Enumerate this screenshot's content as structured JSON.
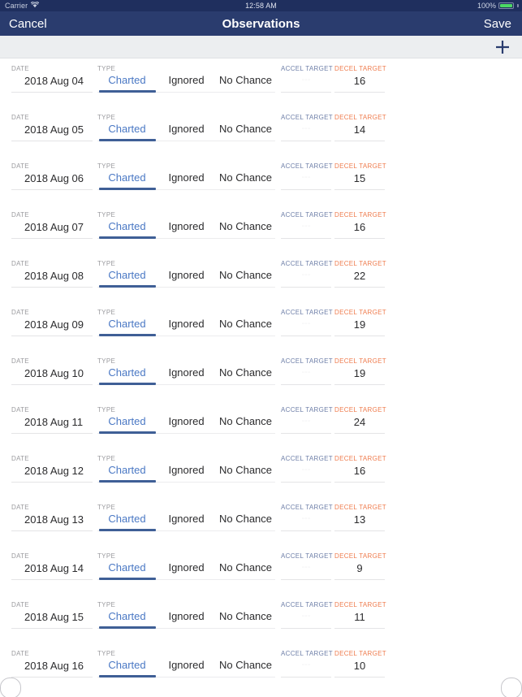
{
  "status_bar": {
    "carrier": "Carrier",
    "wifi_icon": "wifi-icon",
    "time": "12:58 AM",
    "battery_percent": "100%",
    "battery_icon": "battery-full-icon"
  },
  "nav_bar": {
    "cancel_label": "Cancel",
    "title": "Observations",
    "save_label": "Save"
  },
  "toolbar": {
    "add_icon": "plus-icon"
  },
  "columns": {
    "date_label": "DATE",
    "type_label": "TYPE",
    "accel_label": "ACCEL TARGET",
    "decel_label": "DECEL TARGET"
  },
  "type_options": [
    "Charted",
    "Ignored",
    "No Chance"
  ],
  "colors": {
    "status_bar_bg": "#1f2f5e",
    "nav_bar_bg": "#2a3c6e",
    "toolbar_bg": "#eceef0",
    "selected_segment": "#4a78c4",
    "segment_underline": "#3f5f96",
    "accel_label": "#6e7fa8",
    "decel_label": "#ef7c4e",
    "battery_green": "#4cd964"
  },
  "rows": [
    {
      "date": "2018 Aug 04",
      "type": "Charted",
      "accel": "",
      "decel": "16"
    },
    {
      "date": "2018 Aug 05",
      "type": "Charted",
      "accel": "",
      "decel": "14"
    },
    {
      "date": "2018 Aug 06",
      "type": "Charted",
      "accel": "",
      "decel": "15"
    },
    {
      "date": "2018 Aug 07",
      "type": "Charted",
      "accel": "",
      "decel": "16"
    },
    {
      "date": "2018 Aug 08",
      "type": "Charted",
      "accel": "",
      "decel": "22"
    },
    {
      "date": "2018 Aug 09",
      "type": "Charted",
      "accel": "",
      "decel": "19"
    },
    {
      "date": "2018 Aug 10",
      "type": "Charted",
      "accel": "",
      "decel": "19"
    },
    {
      "date": "2018 Aug 11",
      "type": "Charted",
      "accel": "",
      "decel": "24"
    },
    {
      "date": "2018 Aug 12",
      "type": "Charted",
      "accel": "",
      "decel": "16"
    },
    {
      "date": "2018 Aug 13",
      "type": "Charted",
      "accel": "",
      "decel": "13"
    },
    {
      "date": "2018 Aug 14",
      "type": "Charted",
      "accel": "",
      "decel": "9"
    },
    {
      "date": "2018 Aug 15",
      "type": "Charted",
      "accel": "",
      "decel": "11"
    },
    {
      "date": "2018 Aug 16",
      "type": "Charted",
      "accel": "",
      "decel": "10"
    }
  ]
}
